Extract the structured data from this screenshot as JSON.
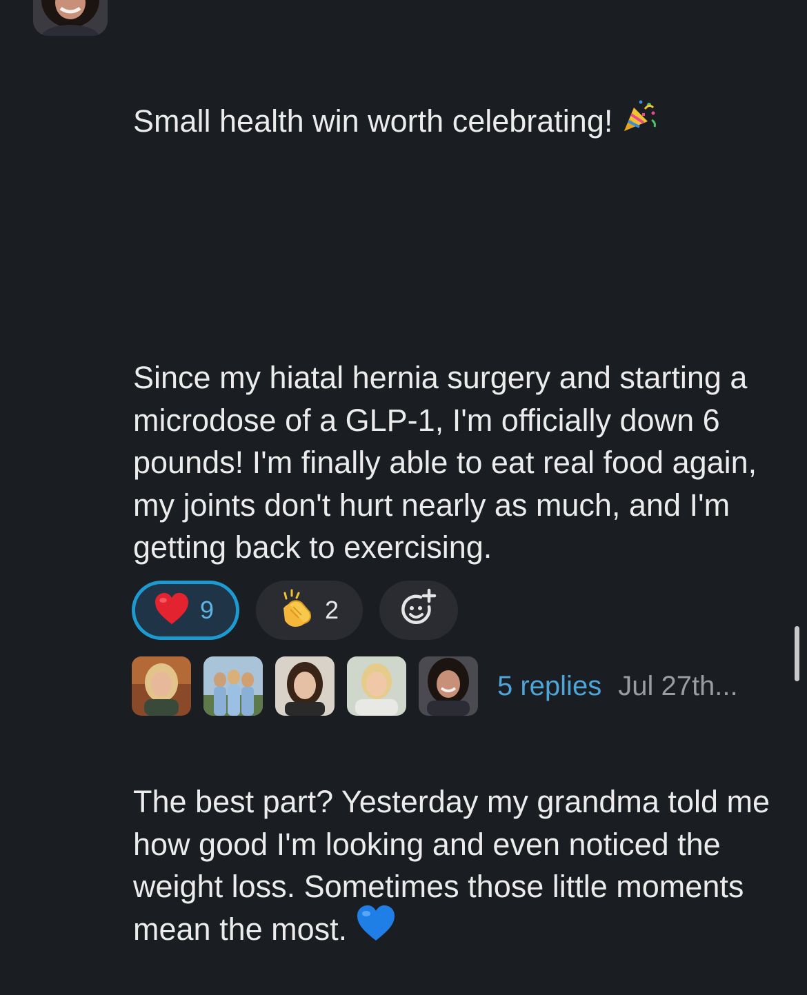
{
  "author": {
    "avatar_icon": "profile-photo"
  },
  "message": {
    "paragraphs": [
      "Small health win worth celebrating!",
      "Since my hiatal hernia surgery and starting a microdose of a GLP-1, I'm officially down 6 pounds! I'm finally able to eat real food again, my joints don't hurt nearly as much, and I'm getting back to exercising.",
      "The best part? Yesterday my grandma told me how good I'm looking and even noticed the weight loss. Sometimes those little moments mean the most."
    ],
    "emoji_1": "party-popper-icon",
    "emoji_2": "blue-heart-icon"
  },
  "reactions": [
    {
      "emoji": "red-heart-icon",
      "count": "9",
      "selected": true
    },
    {
      "emoji": "clapping-hands-icon",
      "count": "2",
      "selected": false
    }
  ],
  "add_reaction_icon": "add-emoji-icon",
  "thread": {
    "participant_avatars": [
      "participant-1",
      "participant-2",
      "participant-3",
      "participant-4",
      "participant-5"
    ],
    "replies_label": "5 replies",
    "timestamp": "Jul 27th..."
  },
  "colors": {
    "background": "#1a1d21",
    "selected_border": "#1d9bd1",
    "link": "#4ea5d8"
  }
}
